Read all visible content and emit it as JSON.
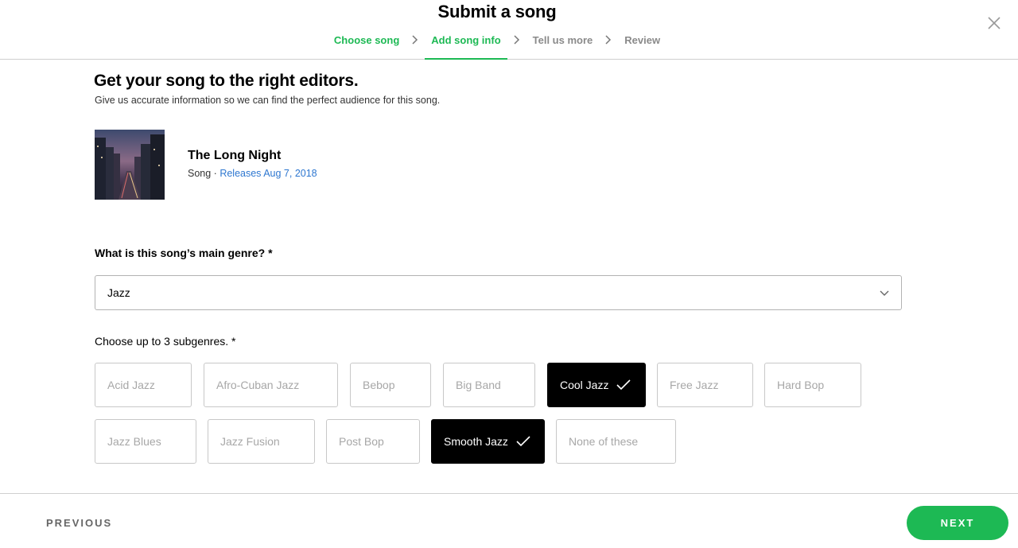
{
  "header": {
    "title": "Submit a song",
    "steps": [
      {
        "label": "Choose song",
        "state": "done"
      },
      {
        "label": "Add song info",
        "state": "active"
      },
      {
        "label": "Tell us more",
        "state": "todo"
      },
      {
        "label": "Review",
        "state": "todo"
      }
    ]
  },
  "intro": {
    "heading": "Get your song to the right editors.",
    "subheading": "Give us accurate information so we can find the perfect audience for this song."
  },
  "song": {
    "title": "The Long Night",
    "type": "Song",
    "separator": " · ",
    "release": "Releases Aug 7, 2018"
  },
  "genre": {
    "question": "What is this song’s main genre? *",
    "selected": "Jazz"
  },
  "subgenres": {
    "question": "Choose up to 3 subgenres. *",
    "options": [
      {
        "label": "Acid Jazz",
        "selected": false
      },
      {
        "label": "Afro-Cuban Jazz",
        "selected": false
      },
      {
        "label": "Bebop",
        "selected": false
      },
      {
        "label": "Big Band",
        "selected": false
      },
      {
        "label": "Cool Jazz",
        "selected": true
      },
      {
        "label": "Free Jazz",
        "selected": false
      },
      {
        "label": "Hard Bop",
        "selected": false
      },
      {
        "label": "Jazz Blues",
        "selected": false
      },
      {
        "label": "Jazz Fusion",
        "selected": false
      },
      {
        "label": "Post Bop",
        "selected": false
      },
      {
        "label": "Smooth Jazz",
        "selected": true
      },
      {
        "label": "None of these",
        "selected": false
      }
    ]
  },
  "footer": {
    "previous_label": "PREVIOUS",
    "next_label": "NEXT"
  },
  "colors": {
    "accent": "#1db954",
    "link": "#2e77d0",
    "selected_chip": "#000000"
  },
  "icons": {
    "close": "close-icon",
    "step_separator": "chevron-right-icon",
    "dropdown": "chevron-down-icon",
    "check": "check-icon"
  }
}
